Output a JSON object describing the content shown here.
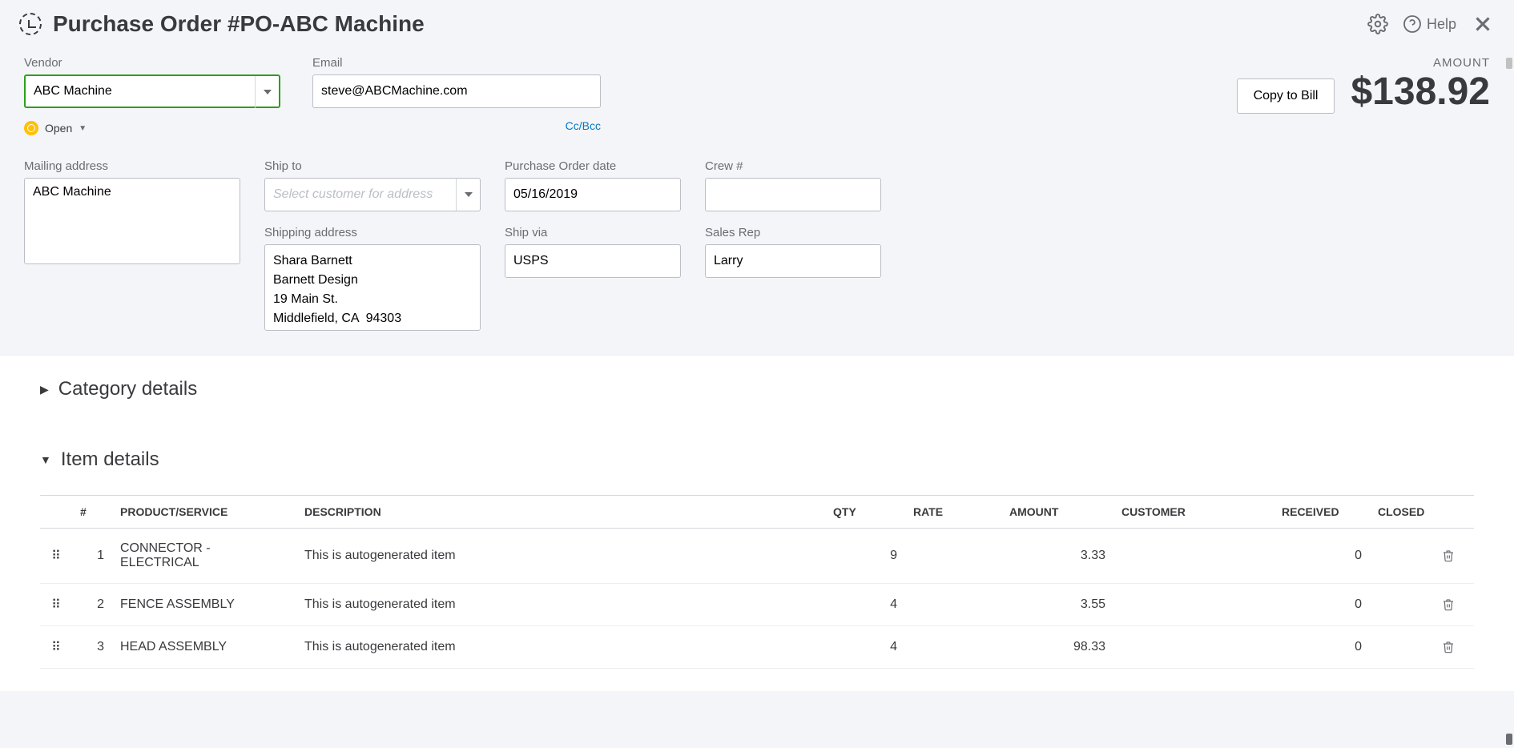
{
  "header": {
    "title": "Purchase Order #PO-ABC Machine",
    "help": "Help"
  },
  "vendor": {
    "label": "Vendor",
    "value": "ABC Machine",
    "status": "Open"
  },
  "email": {
    "label": "Email",
    "value": "steve@ABCMachine.com",
    "ccbcc": "Cc/Bcc"
  },
  "amount": {
    "label": "AMOUNT",
    "value": "$138.92",
    "copy_btn": "Copy to Bill"
  },
  "mailing": {
    "label": "Mailing address",
    "value": "ABC Machine"
  },
  "shipto": {
    "label": "Ship to",
    "placeholder": "Select customer for address"
  },
  "shipping": {
    "label": "Shipping address",
    "value": "Shara Barnett\nBarnett Design\n19 Main St.\nMiddlefield, CA  94303"
  },
  "podate": {
    "label": "Purchase Order date",
    "value": "05/16/2019"
  },
  "crew": {
    "label": "Crew #",
    "value": ""
  },
  "shipvia": {
    "label": "Ship via",
    "value": "USPS"
  },
  "salesrep": {
    "label": "Sales Rep",
    "value": "Larry"
  },
  "sections": {
    "category": "Category details",
    "items": "Item details"
  },
  "table": {
    "headers": {
      "num": "#",
      "product": "PRODUCT/SERVICE",
      "description": "DESCRIPTION",
      "qty": "QTY",
      "rate": "RATE",
      "amount": "AMOUNT",
      "customer": "CUSTOMER",
      "received": "RECEIVED",
      "closed": "CLOSED"
    },
    "rows": [
      {
        "num": "1",
        "product": "CONNECTOR - ELECTRICAL",
        "description": "This is autogenerated item",
        "qty": "9",
        "rate": "",
        "amount": "3.33",
        "customer": "",
        "received": "0"
      },
      {
        "num": "2",
        "product": "FENCE ASSEMBLY",
        "description": "This is autogenerated item",
        "qty": "4",
        "rate": "",
        "amount": "3.55",
        "customer": "",
        "received": "0"
      },
      {
        "num": "3",
        "product": "HEAD ASSEMBLY",
        "description": "This is autogenerated item",
        "qty": "4",
        "rate": "",
        "amount": "98.33",
        "customer": "",
        "received": "0"
      }
    ]
  }
}
